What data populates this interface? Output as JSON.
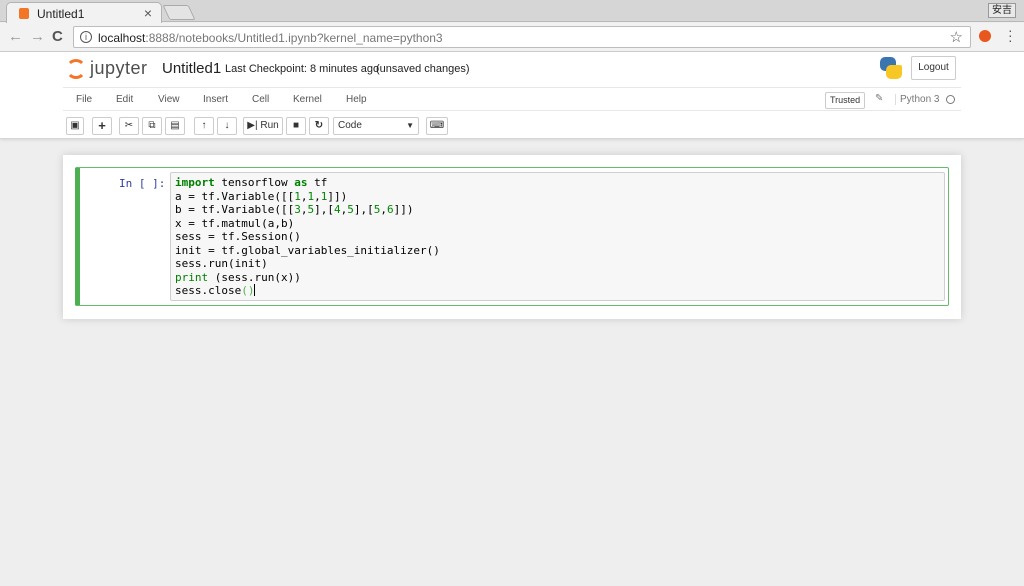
{
  "browser": {
    "tab_title": "Untitled1",
    "tab_close": "×",
    "ime_badge": "安吉",
    "url_host": "localhost",
    "url_rest": ":8888/notebooks/Untitled1.ipynb?kernel_name=python3",
    "back": "←",
    "forward": "→",
    "reload": "C",
    "star": "☆",
    "menu": "⋮"
  },
  "jupyter": {
    "logo_text": "jupyter",
    "notebook_name": "Untitled1",
    "checkpoint": "Last Checkpoint: 8 minutes ago",
    "unsaved": "(unsaved changes)",
    "logout": "Logout",
    "menus": [
      "File",
      "Edit",
      "View",
      "Insert",
      "Cell",
      "Kernel",
      "Help"
    ],
    "trusted": "Trusted",
    "kernel": "Python 3",
    "run_label": "Run",
    "cell_type": "Code"
  },
  "cell": {
    "prompt": "In [ ]:",
    "lines": [
      "import tensorflow as tf",
      "a = tf.Variable([[1,1,1]])",
      "b = tf.Variable([[3,5],[4,5],[5,6]])",
      "x = tf.matmul(a,b)",
      "sess = tf.Session()",
      "init = tf.global_variables_initializer()",
      "sess.run(init)",
      "print (sess.run(x))",
      "sess.close()"
    ]
  },
  "colors": {
    "accent_orange": "#f37626",
    "cell_border": "#4caf50",
    "prompt_blue": "#303f9f",
    "keyword_green": "#008000"
  }
}
